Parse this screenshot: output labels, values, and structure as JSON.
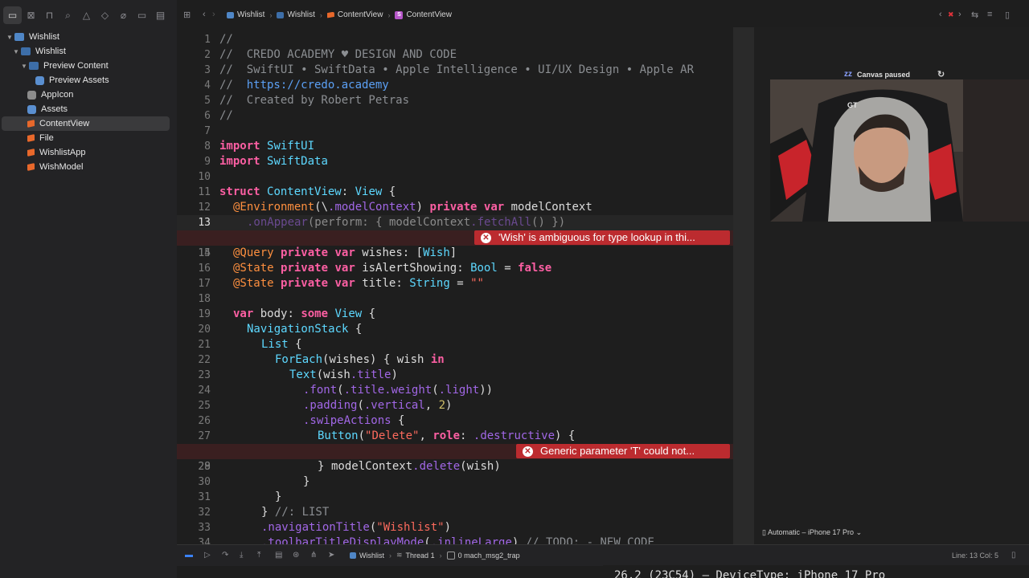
{
  "navigator": {
    "items": [
      {
        "label": "Wishlist",
        "icon": "project-icon"
      },
      {
        "label": "Wishlist",
        "icon": "folder-icon"
      },
      {
        "label": "Preview Content",
        "icon": "folder-icon"
      },
      {
        "label": "Preview Assets",
        "icon": "asset-catalog-icon"
      },
      {
        "label": "AppIcon",
        "icon": "app-icon-icon"
      },
      {
        "label": "Assets",
        "icon": "asset-catalog-icon"
      },
      {
        "label": "ContentView",
        "icon": "swift-file-icon"
      },
      {
        "label": "File",
        "icon": "swift-file-icon"
      },
      {
        "label": "WishlistApp",
        "icon": "swift-file-icon"
      },
      {
        "label": "WishModel",
        "icon": "swift-file-icon"
      }
    ]
  },
  "jumpbar": {
    "project": "Wishlist",
    "folder": "Wishlist",
    "file": "ContentView",
    "symbol": "ContentView"
  },
  "code": {
    "lines": [
      {
        "num": "1",
        "text": "//"
      },
      {
        "num": "2",
        "text": "//  CREDO ACADEMY ♥ DESIGN AND CODE"
      },
      {
        "num": "3",
        "text": "//  SwiftUI • SwiftData • Apple Intelligence • UI/UX Design • Apple AR"
      },
      {
        "num": "4",
        "text": "https://credo.academy"
      },
      {
        "num": "5",
        "text": "//  Created by Robert Petras"
      },
      {
        "num": "6",
        "text": "//"
      },
      {
        "num": "7",
        "text": ""
      },
      {
        "num": "8",
        "text": "import SwiftUI"
      },
      {
        "num": "9",
        "text": "import SwiftData"
      },
      {
        "num": "10",
        "text": ""
      },
      {
        "num": "11",
        "text": "struct ContentView: View {"
      },
      {
        "num": "12",
        "text": "@Environment(\\.modelContext) private var modelContext"
      },
      {
        "num": "13",
        "text": ".onAppear(perform: { modelContext.fetchAll() })"
      },
      {
        "num": "14",
        "text": "@Query private var wishes: [Wish]"
      },
      {
        "num": "15",
        "text": ""
      },
      {
        "num": "16",
        "text": "@State private var isAlertShowing: Bool = false"
      },
      {
        "num": "17",
        "text": "@State private var title: String = \"\""
      },
      {
        "num": "18",
        "text": ""
      },
      {
        "num": "19",
        "text": "var body: some View {"
      },
      {
        "num": "20",
        "text": "NavigationStack {"
      },
      {
        "num": "21",
        "text": "List {"
      },
      {
        "num": "22",
        "text": "ForEach(wishes) { wish in"
      },
      {
        "num": "23",
        "text": "Text(wish.title)"
      },
      {
        "num": "24",
        "text": ".font(.title.weight(.light))"
      },
      {
        "num": "25",
        "text": ".padding(.vertical, 2)"
      },
      {
        "num": "26",
        "text": ".swipeActions {"
      },
      {
        "num": "27",
        "text": "Button(\"Delete\", role: .destructive) {"
      },
      {
        "num": "28",
        "text": "modelContext.delete(wish)"
      },
      {
        "num": "29",
        "text": "}"
      },
      {
        "num": "30",
        "text": "}"
      },
      {
        "num": "31",
        "text": "}"
      },
      {
        "num": "32",
        "text": "} //: LIST"
      },
      {
        "num": "33",
        "text": ".navigationTitle(\"Wishlist\")"
      },
      {
        "num": "34",
        "text": ".toolbarTitleDisplayMode(.inlineLarge) // TODO: - NEW CODE"
      }
    ],
    "errors": {
      "line14": "'Wish' is ambiguous for type lookup in thi...",
      "line28": "Generic parameter 'T' could not..."
    }
  },
  "canvas": {
    "status": "Canvas paused",
    "device": "Automatic – iPhone 17 Pro"
  },
  "debugbar": {
    "target": "Wishlist",
    "thread": "Thread 1",
    "frame": "0 mach_msg2_trap",
    "cursor": "Line: 13  Col: 5"
  },
  "console": {
    "text": "26.2 (23C54) – DeviceType: iPhone 17 Pro"
  },
  "colors": {
    "error": "#bc2b2f",
    "keyword": "#fc5fa3",
    "type": "#5dd8ff",
    "string": "#fc6a5d"
  }
}
